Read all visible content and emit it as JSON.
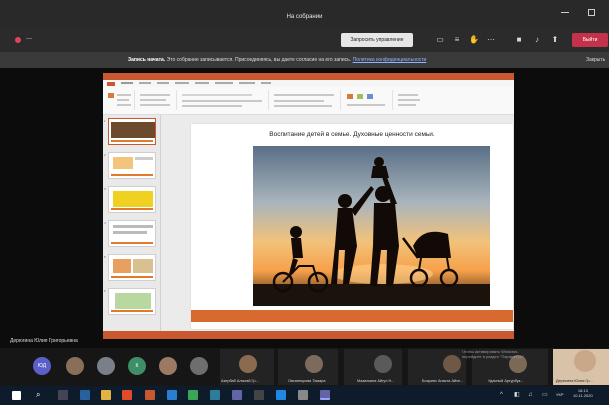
{
  "window": {
    "meeting_title": "На собрании"
  },
  "toolbar": {
    "recording_time": "—",
    "stop_sharing_label": "Запросить управление",
    "leave_label": "Выйти"
  },
  "banner": {
    "bold": "Запись начата.",
    "text": "Это собрание записывается. Присоединяясь, вы даете согласие на его запись.",
    "link": "Политика конфиденциальности",
    "close_label": "Закрыть"
  },
  "presenter": {
    "name": "Дерюгина Юлия Григорьевна"
  },
  "slide": {
    "title": "Воспитание детей в семье. Духовные ценности семьи."
  },
  "participants": [
    {
      "name": "Азербаб Алыхай Гр...",
      "color": "#8a6b4f"
    },
    {
      "name": "Овсянецкова Тамара",
      "color": "#7c6a5c"
    },
    {
      "name": "Мазилкина Айгул Н...",
      "color": "#5a5a5a"
    },
    {
      "name": "Бояринс Анаста Айхе...",
      "color": "#6f5845"
    },
    {
      "name": "Удачный Артурбук...",
      "color": "#7a6a55"
    },
    {
      "name": "Дерюгина Юлия Гр...",
      "color": "#c9a88a"
    }
  ],
  "activation": {
    "line1": "Чтобы активировать Windows,",
    "line2": "перейдите в раздел \"Параметры\"."
  },
  "taskbar": {
    "language": "УКР",
    "time": "16:13",
    "date": "10.11.2020"
  }
}
